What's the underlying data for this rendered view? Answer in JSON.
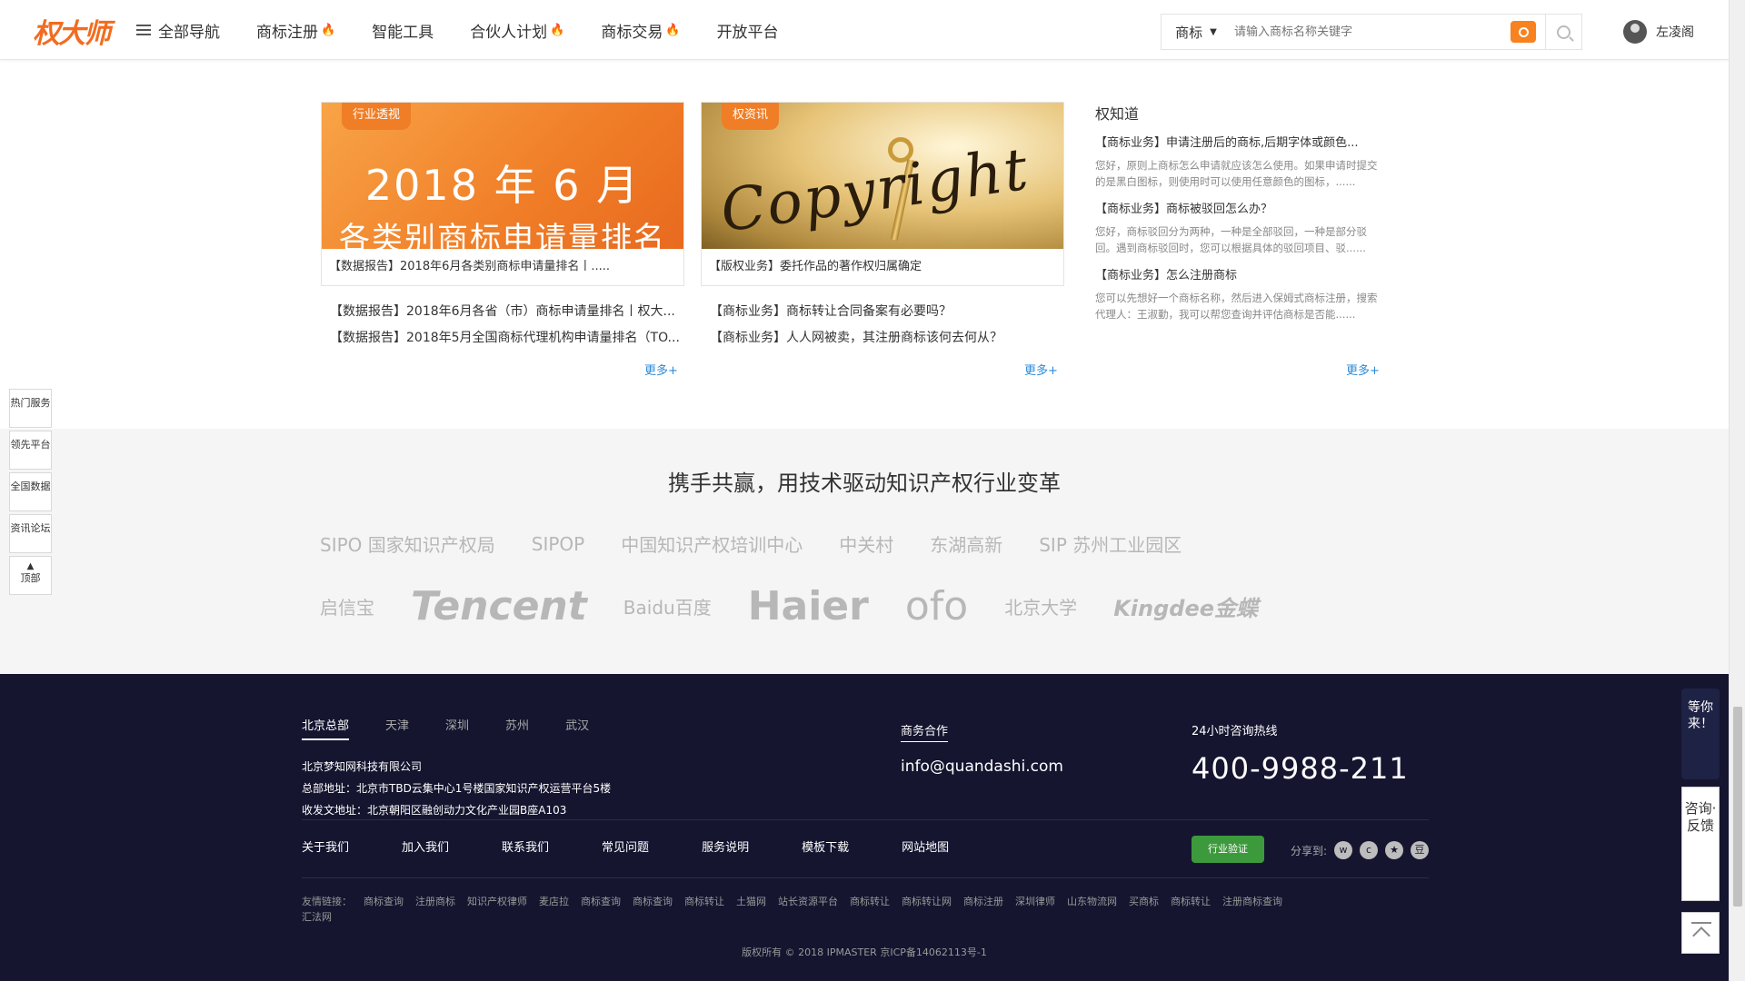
{
  "header": {
    "logo": "权大师",
    "nav": [
      {
        "label": "全部导航",
        "hot": false
      },
      {
        "label": "商标注册",
        "hot": true
      },
      {
        "label": "智能工具",
        "hot": false
      },
      {
        "label": "合伙人计划",
        "hot": true
      },
      {
        "label": "商标交易",
        "hot": true
      },
      {
        "label": "开放平台",
        "hot": false
      }
    ],
    "search_category": "商标",
    "search_placeholder": "请输入商标名称关键字",
    "user_name": "左凌阁"
  },
  "cards": [
    {
      "tag": "行业透视",
      "image_line1": "2018 年 6 月",
      "image_line2": "各类别商标申请量排名",
      "caption": "【数据报告】2018年6月各类别商标申请量排名丨.....",
      "list": [
        "【数据报告】2018年6月各省（市）商标申请量排名丨权大...",
        "【数据报告】2018年5月全国商标代理机构申请量排名（TO..."
      ],
      "more": "更多+"
    },
    {
      "tag": "权资讯",
      "image_text": "Copyright",
      "caption": "【版权业务】委托作品的著作权归属确定",
      "list": [
        "【商标业务】商标转让合同备案有必要吗？",
        "【商标业务】人人网被卖，其注册商标该何去何从？"
      ],
      "more": "更多+"
    }
  ],
  "qzd": {
    "title": "权知道",
    "items": [
      {
        "q": "【商标业务】申请注册后的商标,后期字体或颜色...",
        "a": "您好，原则上商标怎么申请就应该怎么使用。如果申请时提交的是黑白图标，则使用时可以使用任意颜色的图标，......"
      },
      {
        "q": "【商标业务】商标被驳回怎么办？",
        "a": "您好，商标驳回分为两种，一种是全部驳回，一种是部分驳回。遇到商标驳回时，您可以根据具体的驳回项目、驳......"
      },
      {
        "q": "【商标业务】怎么注册商标",
        "a": "您可以先想好一个商标名称，然后进入保姆式商标注册，搜索代理人：王淑勤，我可以帮您查询并评估商标是否能......"
      }
    ],
    "more": "更多+"
  },
  "side_tabs": [
    "热门服务",
    "领先平台",
    "全国数据",
    "资讯论坛",
    "顶部"
  ],
  "partners": {
    "title": "携手共赢，用技术驱动知识产权行业变革",
    "row1": [
      "SIPO 国家知识产权局",
      "SIPOP",
      "中国知识产权培训中心",
      "中关村",
      "东湖高新",
      "SIP 苏州工业园区"
    ],
    "row2": [
      "启信宝",
      "Tencent",
      "Baidu百度",
      "Haier",
      "ofo",
      "北京大学",
      "Kingdee金蝶"
    ]
  },
  "footer": {
    "cities": [
      "北京总部",
      "天津",
      "深圳",
      "苏州",
      "武汉"
    ],
    "company": "北京梦知网科技有限公司",
    "hq_address": "总部地址：北京市TBD云集中心1号楼国家知识产权运营平台5楼",
    "mail_address": "收发文地址：北京朝阳区融创动力文化产业园B座A103",
    "biz_label": "商务合作",
    "biz_email": "info@quandashi.com",
    "hotline_label": "24小时咨询热线",
    "hotline": "400-9988-211",
    "nav": [
      "关于我们",
      "加入我们",
      "联系我们",
      "常见问题",
      "服务说明",
      "模板下载",
      "网站地图"
    ],
    "verify_badge": "行业验证",
    "share_label": "分享到:",
    "friend_links_label": "友情链接：",
    "friend_links": [
      "商标查询",
      "注册商标",
      "知识产权律师",
      "麦店拉",
      "商标查询",
      "商标查询",
      "商标转让",
      "土猫网",
      "站长资源平台",
      "商标转让",
      "商标转让网",
      "商标注册",
      "深圳律师",
      "山东物流网",
      "买商标",
      "商标转让",
      "注册商标查询",
      "汇法网"
    ],
    "copyright": "版权所有 © 2018 IPMASTER 京ICP备14062113号-1"
  },
  "widgets": {
    "wait": "等你来！",
    "consult": "咨询·反馈"
  }
}
